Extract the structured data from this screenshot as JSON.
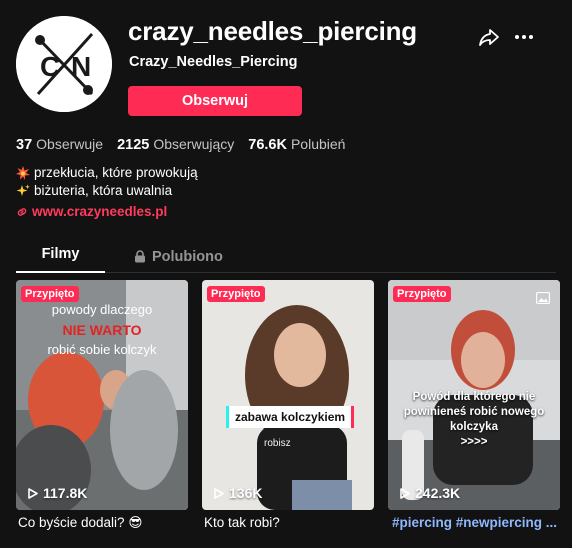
{
  "profile": {
    "avatar_letters": "CXN",
    "username": "crazy_needles_piercing",
    "nickname": "Crazy_Needles_Piercing",
    "follow_label": "Obserwuj",
    "share_icon": "share-arrow-icon",
    "more_icon": "more-dots-icon"
  },
  "stats": {
    "following_count": "37",
    "following_label": "Obserwuje",
    "followers_count": "2125",
    "followers_label": "Obserwujący",
    "likes_count": "76.6K",
    "likes_label": "Polubień"
  },
  "bio": {
    "line1_emoji": "collision-icon",
    "line1_text": "przekłucia, które prowokują",
    "line2_emoji": "sparkles-icon",
    "line2_text": "biżuteria, która uwalnia",
    "link_icon": "link-icon",
    "link_text": "www.crazyneedles.pl"
  },
  "tabs": {
    "videos": "Filmy",
    "liked": "Polubiono",
    "liked_icon": "lock-icon"
  },
  "videos": [
    {
      "pinned_label": "Przypięto",
      "overlay_line1": "powody dlaczego",
      "overlay_line2": "NIE WARTO",
      "overlay_line3": "robić sobie kolczyk",
      "views": "117.8K",
      "caption": "Co byście dodali? 😎"
    },
    {
      "pinned_label": "Przypięto",
      "overlay_sticker": "zabawa kolczykiem",
      "overlay_sub": "robisz",
      "views": "136K",
      "caption": "Kto tak robi?"
    },
    {
      "pinned_label": "Przypięto",
      "overlay_line1": "Powód dla którego nie",
      "overlay_line2": "powinieneś robić nowego",
      "overlay_line3": "kolczyka",
      "overlay_line4": ">>>>",
      "views": "242.3K",
      "caption": "#piercing #newpiercing ..."
    }
  ],
  "colors": {
    "accent": "#fe2c55",
    "background": "#121212",
    "link": "#ff3b5c",
    "hashtag": "#8fb8ff"
  }
}
